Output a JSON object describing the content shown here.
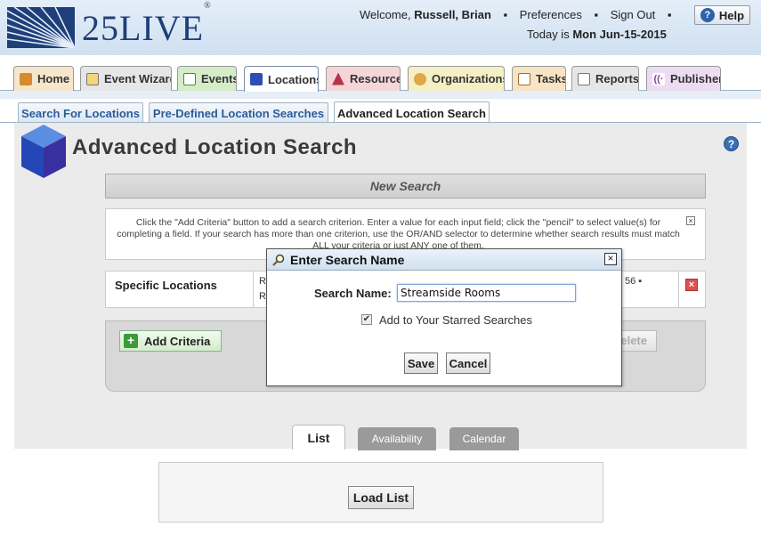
{
  "header": {
    "logo": "25LIVE",
    "logo_mark": "®",
    "welcome": "Welcome,",
    "user_name": "Russell, Brian",
    "preferences": "Preferences",
    "sign_out": "Sign Out",
    "today_prefix": "Today is",
    "today_date": "Mon Jun-15-2015",
    "help": "Help"
  },
  "main_tabs": [
    {
      "label": "Home"
    },
    {
      "label": "Event Wizard"
    },
    {
      "label": "Events"
    },
    {
      "label": "Locations"
    },
    {
      "label": "Resources"
    },
    {
      "label": "Organizations"
    },
    {
      "label": "Tasks"
    },
    {
      "label": "Reports"
    },
    {
      "label": "Publisher"
    }
  ],
  "sub_tabs": [
    {
      "label": "Search For Locations"
    },
    {
      "label": "Pre-Defined Location Searches"
    },
    {
      "label": "Advanced Location Search"
    }
  ],
  "page": {
    "title": "Advanced Location Search",
    "new_search": "New Search",
    "instructions": "Click the \"Add Criteria\" button to add a search criterion. Enter a value for each input field; click the \"pencil\" to select value(s) for completing a field. If your search has more than one criterion, use the OR/AND selector to determine whether search results must match ALL your criteria or just ANY one of them.",
    "criteria_label": "Specific Locations",
    "criteria_fragment_1": "R",
    "criteria_fragment_2": "R",
    "criteria_fragment_3": "56 ▪",
    "add_criteria": "Add Criteria",
    "delete": "Delete"
  },
  "result_tabs": {
    "list": "List",
    "availability": "Availability",
    "calendar": "Calendar"
  },
  "load_list": "Load List",
  "dialog": {
    "title": "Enter Search Name",
    "search_name_label": "Search Name:",
    "search_name_value": "Streamside Rooms",
    "starred_label": "Add to Your Starred Searches",
    "starred_checked": true,
    "save": "Save",
    "cancel": "Cancel"
  }
}
